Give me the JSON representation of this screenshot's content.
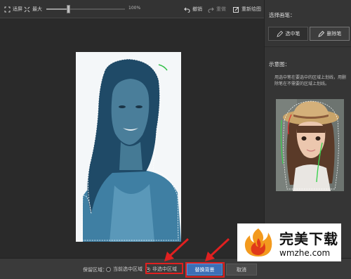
{
  "toolbar": {
    "fit_label": "适屏",
    "max_label": "最大",
    "zoom_value": "100%",
    "zoom_fraction": 0.28,
    "undo_label": "撤销",
    "redo_label": "重做",
    "redraw_label": "重新绘图"
  },
  "panel": {
    "title": "选择画笔：",
    "select_brush_label": "选中笔",
    "delete_brush_label": "删除笔",
    "example_title": "示意图：",
    "example_desc": "用选中笔在要选中的区域上划线，用删除笔在不需要的区域上划线。"
  },
  "bottom": {
    "keep_label": "保留区域：",
    "radio_current": "当前选中区域",
    "radio_noncurrent": "非选中区域",
    "replace_label": "替换背景",
    "cancel_label": "取消"
  },
  "watermark": {
    "cn": "完美下载",
    "url": "wmzhe.com"
  },
  "colors": {
    "accent_blue": "#3c6fb6",
    "highlight_red": "#e02020",
    "selection_overlay": "#2d6a96"
  }
}
